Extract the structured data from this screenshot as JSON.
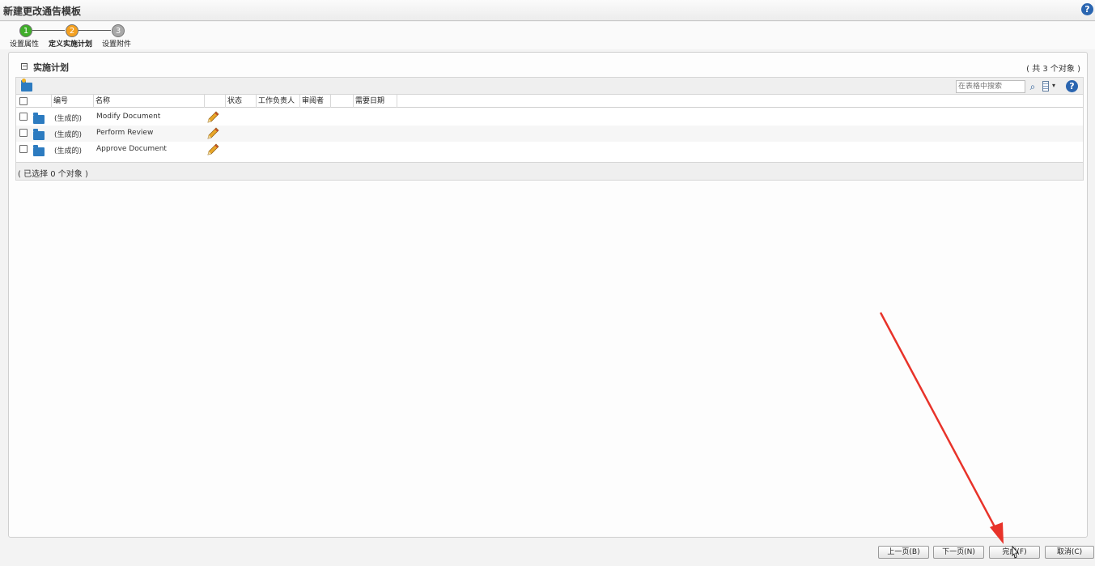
{
  "window": {
    "title": "新建更改通告模板"
  },
  "wizard": {
    "steps": [
      {
        "number": "1",
        "label": "设置属性",
        "state": "done",
        "color": "#3fae29"
      },
      {
        "number": "2",
        "label": "定义实施计划",
        "state": "active",
        "color": "#f4a020"
      },
      {
        "number": "3",
        "label": "设置附件",
        "state": "pending",
        "color": "#a8a8a8"
      }
    ]
  },
  "section": {
    "collapse_glyph": "−",
    "title": "实施计划",
    "object_count": "( 共 3 个对象 )"
  },
  "toolbar": {
    "search_placeholder": "在表格中搜索",
    "search_icon": "⌕",
    "help_icon": "?",
    "menu_arrow": "▾"
  },
  "table": {
    "columns": [
      "编号",
      "名称",
      "",
      "状态",
      "工作负责人",
      "审阅者",
      "",
      "需要日期"
    ],
    "rows": [
      {
        "number": "(生成的)",
        "name": "Modify Document"
      },
      {
        "number": "(生成的)",
        "name": "Perform Review"
      },
      {
        "number": "(生成的)",
        "name": "Approve Document"
      }
    ],
    "selection_status": "( 已选择 0 个对象 )"
  },
  "buttons": {
    "previous": "上一页(B)",
    "next": "下一页(N)",
    "finish": "完成(F)",
    "cancel": "取消(C)"
  },
  "top_help_icon": "?",
  "colors": {
    "accent": "#2a65b0",
    "annotation_arrow": "#e8332a"
  }
}
